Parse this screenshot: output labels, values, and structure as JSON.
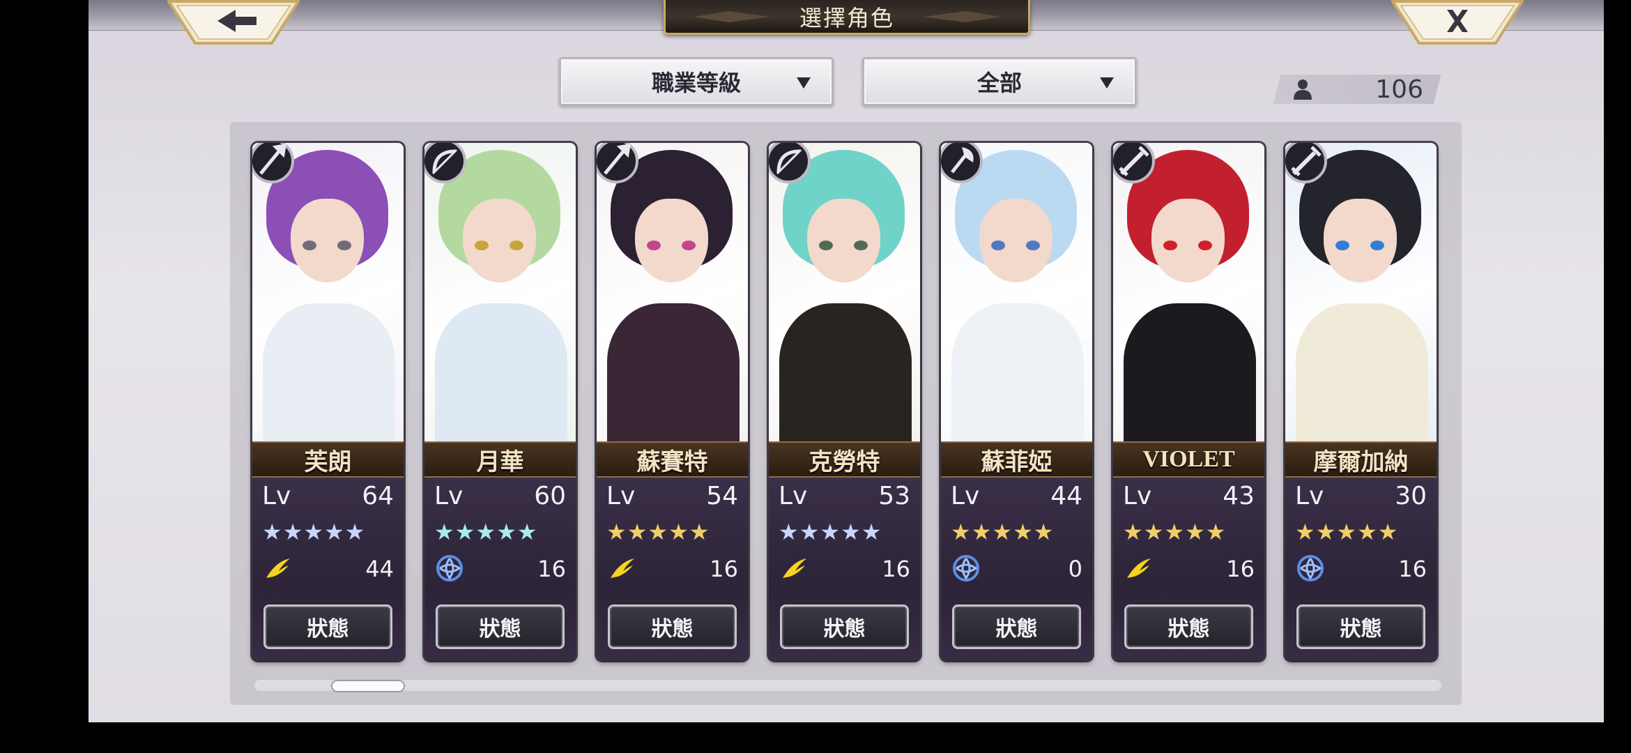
{
  "header": {
    "title": "選擇角色",
    "back_icon": "arrow-left-icon",
    "close_icon": "close-x-icon"
  },
  "filters": {
    "job_level": "職業等級",
    "category": "全部"
  },
  "roster_count": "106",
  "colors": {
    "accent_gold": "#c9a865",
    "star_blue": "#a9c9ff",
    "star_gold": "#f0cf6a",
    "wind_yellow": "#f4d41f",
    "water_blue": "#5b8ee6"
  },
  "characters": [
    {
      "name": "芙朗",
      "lv_label": "Lv",
      "level": "64",
      "stars": "★★★★★",
      "star_color": "#c8d6ff",
      "element": "wind",
      "element_value": "44",
      "status": "狀態",
      "class_icon": "spear-icon",
      "hair": "#8b4fb6",
      "body": "#e9eef5",
      "bg": "#f4f1f6",
      "eye": "#6f6b7b"
    },
    {
      "name": "月華",
      "lv_label": "Lv",
      "level": "60",
      "stars": "★★★★★",
      "star_color": "#a6ecf0",
      "element": "water",
      "element_value": "16",
      "status": "狀態",
      "class_icon": "bow-icon",
      "hair": "#b4d9a0",
      "body": "#dfe9f3",
      "bg": "#eef3ef",
      "eye": "#c8a43a"
    },
    {
      "name": "蘇賽特",
      "lv_label": "Lv",
      "level": "54",
      "stars": "★★★★★",
      "star_color": "#f0cf6a",
      "element": "wind",
      "element_value": "16",
      "status": "狀態",
      "class_icon": "spear-icon",
      "hair": "#2c2033",
      "body": "#3a2635",
      "bg": "#f6f2f4",
      "eye": "#c3458a"
    },
    {
      "name": "克勞特",
      "lv_label": "Lv",
      "level": "53",
      "stars": "★★★★★",
      "star_color": "#c8d6ff",
      "element": "wind",
      "element_value": "16",
      "status": "狀態",
      "class_icon": "bow-icon",
      "hair": "#6fd3c9",
      "body": "#2a2420",
      "bg": "#f3f2ee",
      "eye": "#4f6b57"
    },
    {
      "name": "蘇菲婭",
      "lv_label": "Lv",
      "level": "44",
      "stars": "★★★★★",
      "star_color": "#f0cf6a",
      "element": "water",
      "element_value": "0",
      "status": "狀態",
      "class_icon": "axe-icon",
      "hair": "#bcd9f2",
      "body": "#eef2f7",
      "bg": "#f7f8fb",
      "eye": "#4e79c4"
    },
    {
      "name": "VIOLET",
      "lv_label": "Lv",
      "level": "43",
      "stars": "★★★★★",
      "star_color": "#f0cf6a",
      "element": "wind",
      "element_value": "16",
      "status": "狀態",
      "class_icon": "sword-icon",
      "hair": "#c2202f",
      "body": "#1d1a1f",
      "bg": "#f4f2f3",
      "eye": "#d0202c"
    },
    {
      "name": "摩爾加納",
      "lv_label": "Lv",
      "level": "30",
      "stars": "★★★★★",
      "star_color": "#f0cf6a",
      "element": "water",
      "element_value": "16",
      "status": "狀態",
      "class_icon": "sword-icon",
      "hair": "#23242c",
      "body": "#f0ead8",
      "bg": "#e7eef6",
      "eye": "#2f7ed8"
    }
  ]
}
